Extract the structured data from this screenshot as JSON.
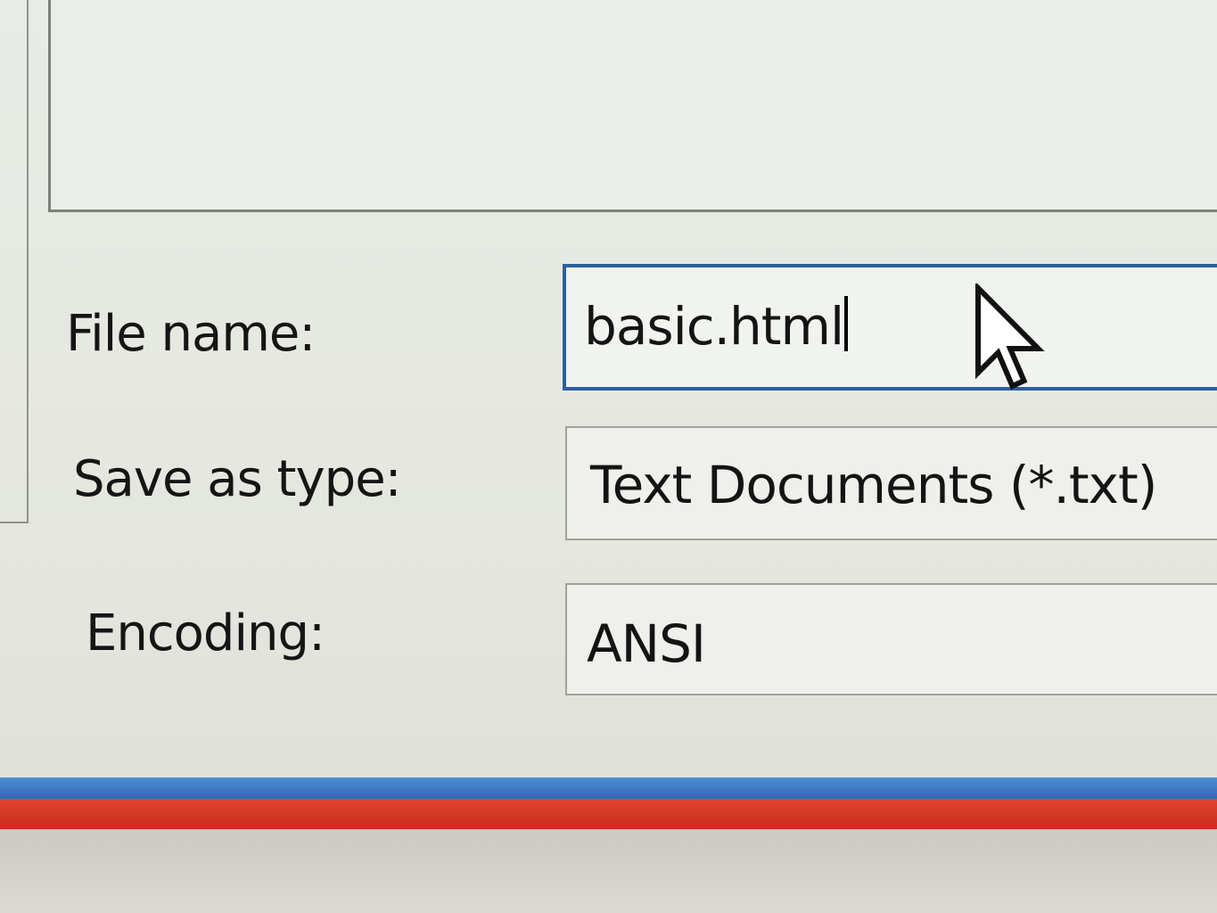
{
  "dialog": {
    "file_name": {
      "label": "File name:",
      "value": "basic.html"
    },
    "save_as_type": {
      "label": "Save as type:",
      "value": "Text Documents (*.txt)"
    },
    "encoding": {
      "label": "Encoding:",
      "value": "ANSI"
    }
  },
  "colors": {
    "focus_border": "#2c5f9e",
    "taskbar_blue": "#3a76c0",
    "taskbar_red": "#d6392a"
  },
  "icons": {
    "pointer": "mouse-pointer-icon"
  }
}
